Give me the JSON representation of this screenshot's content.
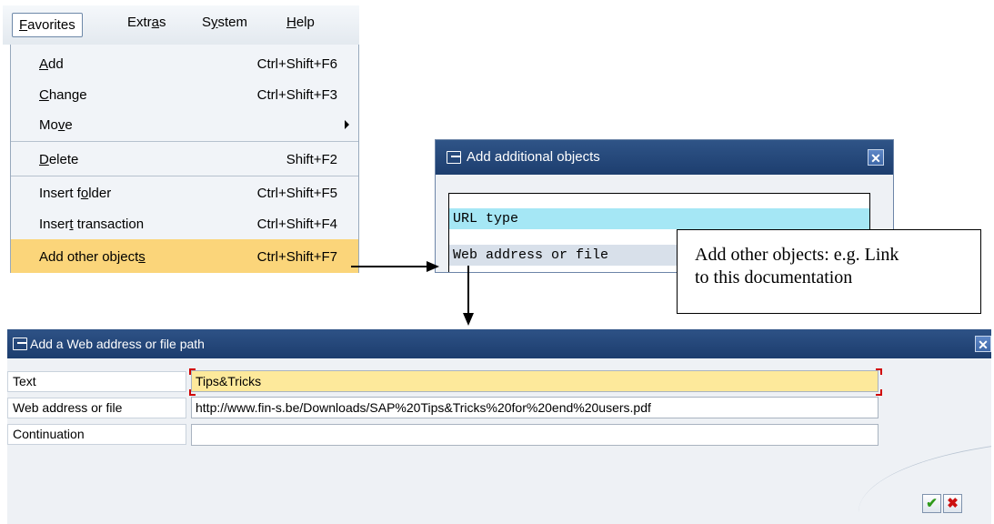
{
  "menubar": {
    "items": [
      {
        "pre": "",
        "u": "F",
        "post": "avorites"
      },
      {
        "pre": "Extr",
        "u": "a",
        "post": "s"
      },
      {
        "pre": "S",
        "u": "y",
        "post": "stem"
      },
      {
        "pre": "",
        "u": "H",
        "post": "elp"
      }
    ]
  },
  "menu": {
    "items": [
      {
        "pre": "",
        "u": "A",
        "post": "dd",
        "shortcut": "Ctrl+Shift+F6"
      },
      {
        "pre": "",
        "u": "C",
        "post": "hange",
        "shortcut": "Ctrl+Shift+F3"
      },
      {
        "pre": "Mo",
        "u": "v",
        "post": "e",
        "shortcut": ""
      },
      {
        "pre": "",
        "u": "D",
        "post": "elete",
        "shortcut": "Shift+F2"
      },
      {
        "pre": "Insert f",
        "u": "o",
        "post": "lder",
        "shortcut": "Ctrl+Shift+F5"
      },
      {
        "pre": "Inser",
        "u": "t",
        "post": " transaction",
        "shortcut": "Ctrl+Shift+F4"
      },
      {
        "pre": "Add other object",
        "u": "s",
        "post": "",
        "shortcut": "Ctrl+Shift+F7"
      }
    ]
  },
  "small_dialog": {
    "title": "Add additional objects",
    "rows": [
      "URL type",
      "Web address or file"
    ]
  },
  "callout": {
    "line1": "Add other objects: e.g. Link",
    "line2": "to this documentation"
  },
  "big_dialog": {
    "title": "Add a Web address or file path",
    "fields": [
      {
        "label": "Text",
        "value": "Tips&Tricks"
      },
      {
        "label": "Web address or file",
        "value": "http://www.fin-s.be/Downloads/SAP%20Tips&Tricks%20for%20end%20users.pdf"
      },
      {
        "label": "Continuation",
        "value": ""
      }
    ],
    "ok_icon": "✔",
    "cancel_icon": "✖"
  },
  "close_glyph": "✕"
}
